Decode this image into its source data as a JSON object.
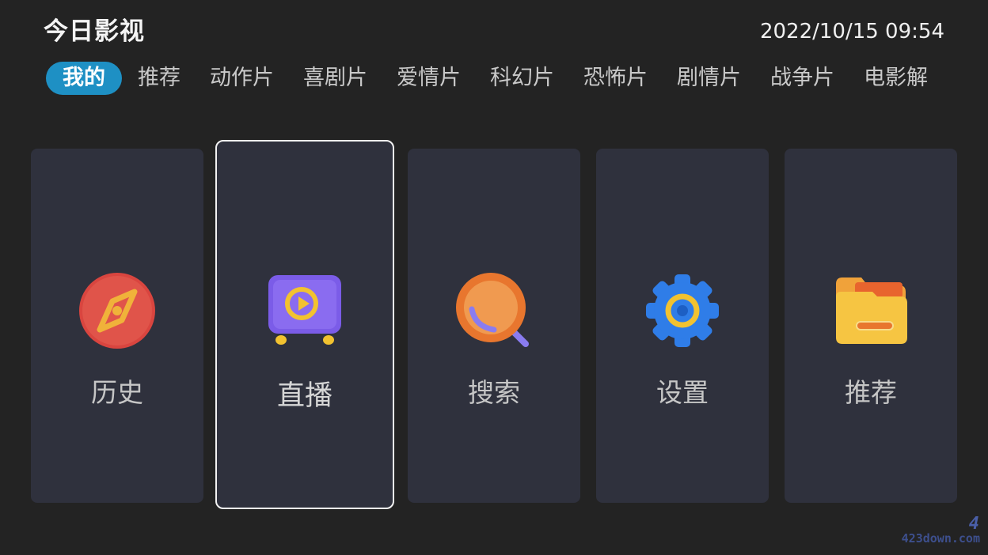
{
  "header": {
    "title": "今日影视",
    "datetime": "2022/10/15 09:54"
  },
  "tabs": [
    {
      "label": "我的",
      "active": true
    },
    {
      "label": "推荐"
    },
    {
      "label": "动作片"
    },
    {
      "label": "喜剧片"
    },
    {
      "label": "爱情片"
    },
    {
      "label": "科幻片"
    },
    {
      "label": "恐怖片"
    },
    {
      "label": "剧情片"
    },
    {
      "label": "战争片"
    },
    {
      "label": "电影解"
    }
  ],
  "cards": [
    {
      "label": "历史",
      "icon": "compass-icon"
    },
    {
      "label": "直播",
      "icon": "tv-play-icon",
      "focused": true
    },
    {
      "label": "搜索",
      "icon": "search-icon"
    },
    {
      "label": "设置",
      "icon": "gear-icon"
    },
    {
      "label": "推荐",
      "icon": "folder-icon"
    }
  ],
  "watermark": {
    "logo": "4",
    "site": "423down.com"
  },
  "colors": {
    "background": "#232323",
    "card": "#2f313d",
    "active_tab": "#1e90c4",
    "focus_border": "#f2f2f2"
  }
}
